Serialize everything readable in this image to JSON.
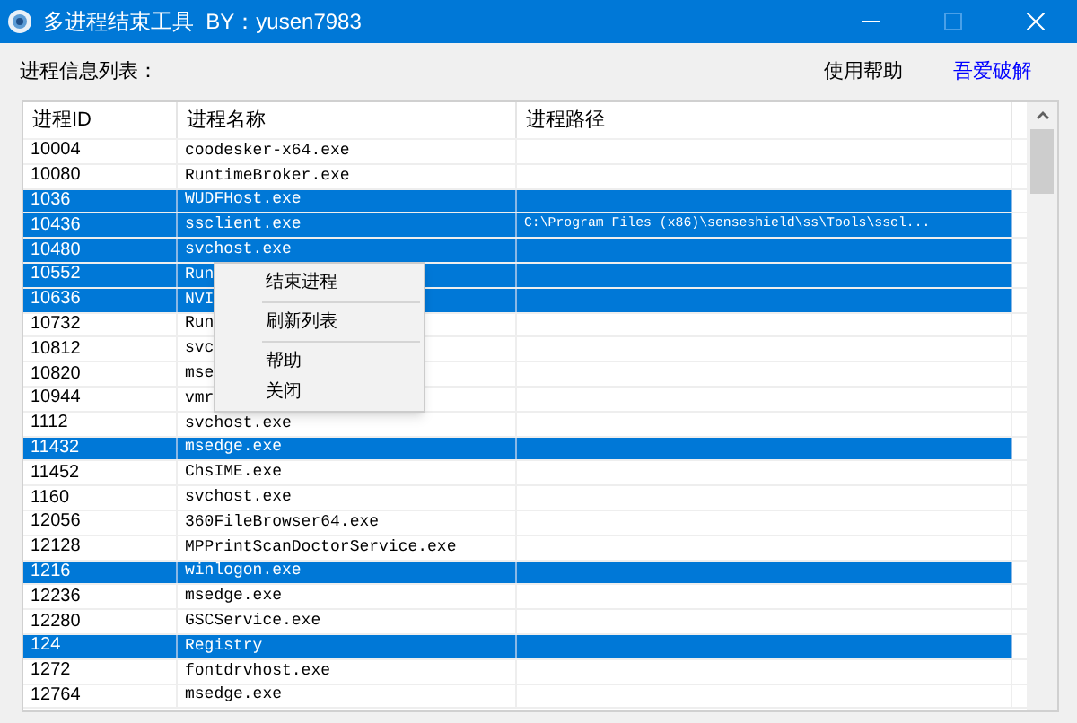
{
  "window": {
    "title": "多进程结束工具  BY：yusen7983",
    "maximize_disabled": true
  },
  "toolbar": {
    "label": "进程信息列表：",
    "help_link": "使用帮助",
    "site_link": "吾爱破解"
  },
  "table": {
    "columns": [
      "进程ID",
      "进程名称",
      "进程路径"
    ],
    "rows": [
      {
        "id": "10004",
        "name": "coodesker-x64.exe",
        "selected": false
      },
      {
        "id": "10080",
        "name": "RuntimeBroker.exe",
        "selected": false
      },
      {
        "id": "1036",
        "name": "WUDFHost.exe",
        "selected": true
      },
      {
        "id": "10436",
        "name": "ssclient.exe",
        "path": "C:\\Program Files (x86)\\senseshield\\ss\\Tools\\sscl...",
        "selected": true
      },
      {
        "id": "10480",
        "name": "svchost.exe",
        "selected": true
      },
      {
        "id": "10552",
        "name": "Run",
        "selected": true
      },
      {
        "id": "10636",
        "name": "NVI",
        "selected": true
      },
      {
        "id": "10732",
        "name": "Run",
        "selected": false
      },
      {
        "id": "10812",
        "name": "svc",
        "selected": false
      },
      {
        "id": "10820",
        "name": "mse",
        "selected": false
      },
      {
        "id": "10944",
        "name": "vmr",
        "selected": false
      },
      {
        "id": "1112",
        "name": "svchost.exe",
        "selected": false
      },
      {
        "id": "11432",
        "name": "msedge.exe",
        "selected": true
      },
      {
        "id": "11452",
        "name": "ChsIME.exe",
        "selected": false
      },
      {
        "id": "1160",
        "name": "svchost.exe",
        "selected": false
      },
      {
        "id": "12056",
        "name": "360FileBrowser64.exe",
        "selected": false
      },
      {
        "id": "12128",
        "name": "MPPrintScanDoctorService.exe",
        "selected": false
      },
      {
        "id": "1216",
        "name": "winlogon.exe",
        "selected": true
      },
      {
        "id": "12236",
        "name": "msedge.exe",
        "selected": false
      },
      {
        "id": "12280",
        "name": "GSCService.exe",
        "selected": false
      },
      {
        "id": "124",
        "name": "Registry",
        "selected": true
      },
      {
        "id": "1272",
        "name": "fontdrvhost.exe",
        "selected": false
      },
      {
        "id": "12764",
        "name": "msedge.exe",
        "selected": false
      }
    ]
  },
  "context_menu": {
    "items": [
      {
        "kind": "item",
        "label": "结束进程"
      },
      {
        "kind": "separator"
      },
      {
        "kind": "item",
        "label": "刷新列表"
      },
      {
        "kind": "separator"
      },
      {
        "kind": "item",
        "label": "帮助"
      },
      {
        "kind": "item",
        "label": "关闭"
      }
    ]
  }
}
